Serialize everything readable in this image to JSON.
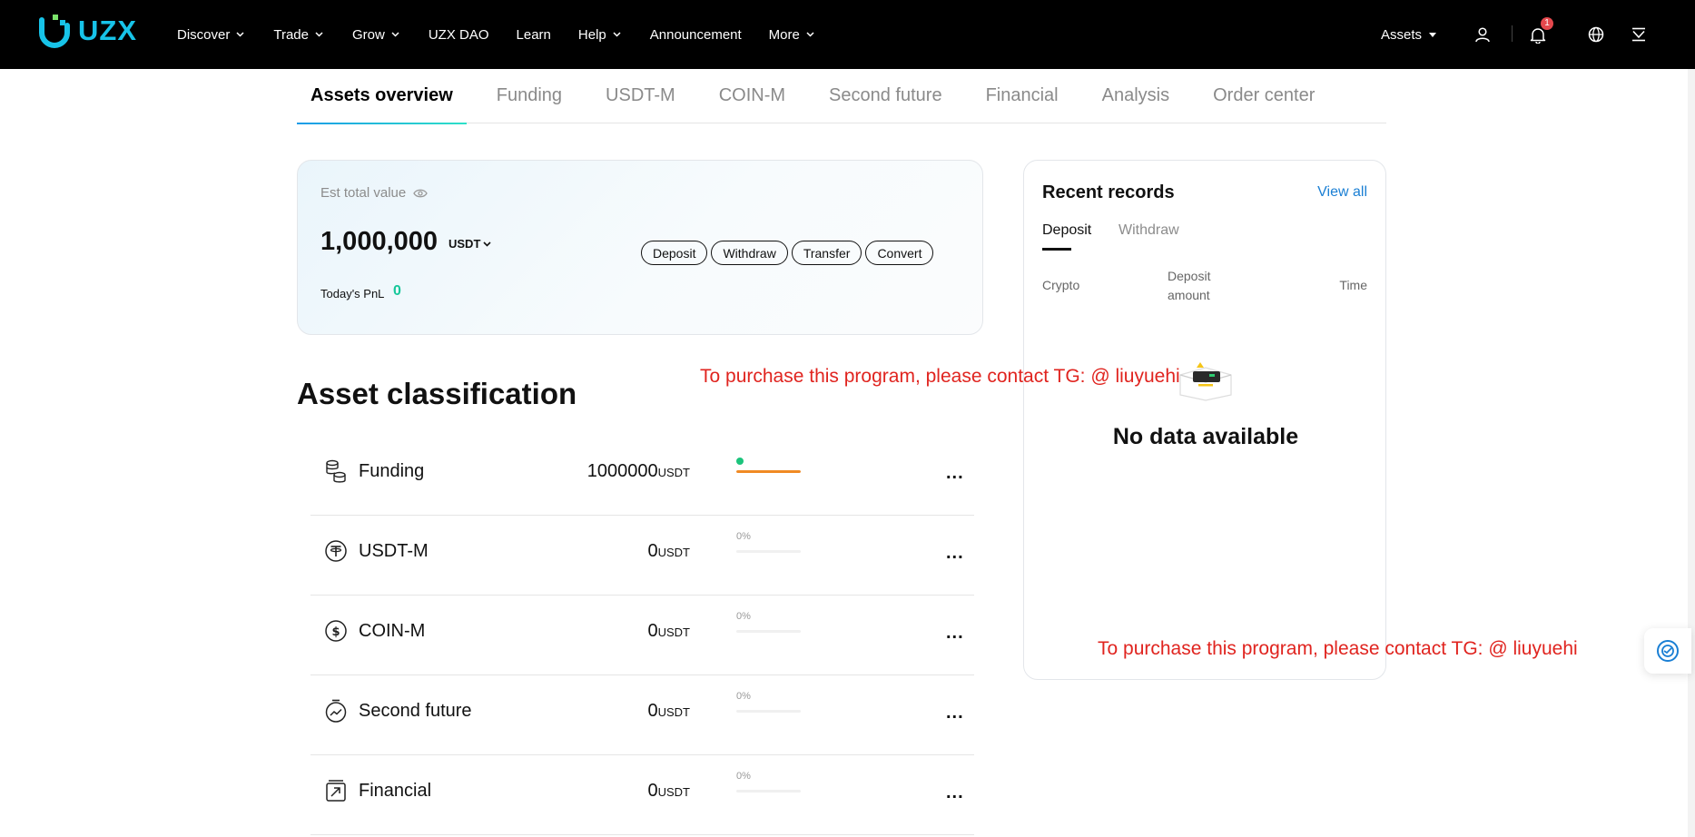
{
  "nav": {
    "logo_text": "UZX",
    "items": [
      {
        "label": "Discover",
        "has_dropdown": true
      },
      {
        "label": "Trade",
        "has_dropdown": true
      },
      {
        "label": "Grow",
        "has_dropdown": true
      },
      {
        "label": "UZX DAO",
        "has_dropdown": false
      },
      {
        "label": "Learn",
        "has_dropdown": false
      },
      {
        "label": "Help",
        "has_dropdown": true
      },
      {
        "label": "Announcement",
        "has_dropdown": false
      },
      {
        "label": "More",
        "has_dropdown": true
      }
    ],
    "assets_label": "Assets",
    "notification_count": "1",
    "icons": [
      "user-icon",
      "bell-icon",
      "globe-icon",
      "download-icon"
    ]
  },
  "tabs": [
    {
      "label": "Assets overview",
      "active": true
    },
    {
      "label": "Funding",
      "active": false
    },
    {
      "label": "USDT-M",
      "active": false
    },
    {
      "label": "COIN-M",
      "active": false
    },
    {
      "label": "Second future",
      "active": false
    },
    {
      "label": "Financial",
      "active": false
    },
    {
      "label": "Analysis",
      "active": false
    },
    {
      "label": "Order center",
      "active": false
    }
  ],
  "overview": {
    "est_label": "Est total value",
    "total_value": "1,000,000",
    "currency": "USDT",
    "pnl_label": "Today's PnL",
    "pnl_value": "0",
    "actions": [
      "Deposit",
      "Withdraw",
      "Transfer",
      "Convert"
    ]
  },
  "classification": {
    "title": "Asset classification",
    "rows": [
      {
        "name": "Funding",
        "amount": "1000000",
        "unit": "USDT",
        "percent_label": "",
        "share": 1.0,
        "icon": "coins-icon"
      },
      {
        "name": "USDT-M",
        "amount": "0",
        "unit": "USDT",
        "percent_label": "0%",
        "share": 0,
        "icon": "tether-icon"
      },
      {
        "name": "COIN-M",
        "amount": "0",
        "unit": "USDT",
        "percent_label": "0%",
        "share": 0,
        "icon": "dollar-coin-icon"
      },
      {
        "name": "Second future",
        "amount": "0",
        "unit": "USDT",
        "percent_label": "0%",
        "share": 0,
        "icon": "stopwatch-icon"
      },
      {
        "name": "Financial",
        "amount": "0",
        "unit": "USDT",
        "percent_label": "0%",
        "share": 0,
        "icon": "box-arrow-icon"
      }
    ],
    "more_label": "..."
  },
  "records": {
    "title": "Recent records",
    "view_all": "View all",
    "tabs": [
      {
        "label": "Deposit",
        "active": true
      },
      {
        "label": "Withdraw",
        "active": false
      }
    ],
    "columns": {
      "crypto": "Crypto",
      "amount_line1": "Deposit",
      "amount_line2": "amount",
      "time": "Time"
    },
    "empty_text": "No data available"
  },
  "watermarks": [
    "To purchase this program, please contact TG: @ liuyuehi",
    "To purchase this program, please contact TG: @ liuyuehi"
  ],
  "colors": {
    "brand": "#17c3e8",
    "positive": "#16c79a",
    "bar_fill": "#f08a24",
    "link": "#1a7fd4",
    "watermark": "#e0241f"
  }
}
